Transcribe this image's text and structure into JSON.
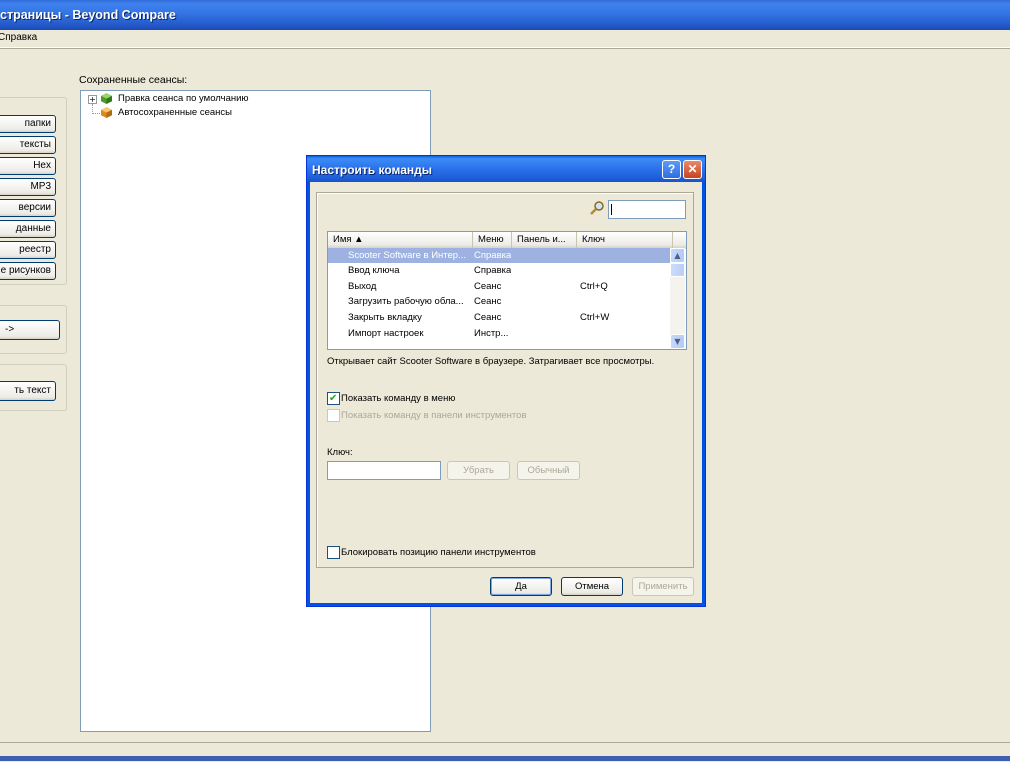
{
  "window": {
    "title": "страницы - Beyond Compare"
  },
  "menu": {
    "items": [
      "Справка"
    ]
  },
  "sidebar": {
    "buttons": [
      "папки",
      "тексты",
      "Hex",
      "MP3",
      "версии",
      "данные",
      "реестр",
      "е рисунков"
    ],
    "middle_button": "->",
    "bottom_button": "ть текст"
  },
  "sessions": {
    "label": "Сохраненные сеансы:",
    "items": [
      {
        "label": "Правка сеанса по умолчанию",
        "expandable": true,
        "icon": "green-cube-icon"
      },
      {
        "label": "Автосохраненные сеансы",
        "expandable": false,
        "icon": "orange-cube-icon"
      }
    ]
  },
  "dialog": {
    "title": "Настроить команды",
    "help_glyph": "?",
    "close_glyph": "✕",
    "search": {
      "value": "",
      "icon": "magnifier-icon"
    },
    "columns": [
      "Имя ▲",
      "Меню",
      "Панель и...",
      "Ключ"
    ],
    "rows": [
      {
        "name": "Scooter Software в Интер...",
        "menu": "Справка",
        "panel": "",
        "key": "",
        "selected": true
      },
      {
        "name": "Ввод ключа",
        "menu": "Справка",
        "panel": "",
        "key": "",
        "selected": false
      },
      {
        "name": "Выход",
        "menu": "Сеанс",
        "panel": "",
        "key": "Ctrl+Q",
        "selected": false
      },
      {
        "name": "Загрузить рабочую обла...",
        "menu": "Сеанс",
        "panel": "",
        "key": "",
        "selected": false
      },
      {
        "name": "Закрыть вкладку",
        "menu": "Сеанс",
        "panel": "",
        "key": "Ctrl+W",
        "selected": false
      },
      {
        "name": "Импорт настроек",
        "menu": "Инстр...",
        "panel": "",
        "key": "",
        "selected": false
      }
    ],
    "description": "Открывает сайт Scooter Software в браузере.  Затрагивает все просмотры.",
    "show_in_menu": {
      "label": "Показать команду в меню",
      "checked": true
    },
    "show_in_toolbar": {
      "label": "Показать команду в панели инструментов",
      "checked": false,
      "enabled": false
    },
    "key_label": "Ключ:",
    "key_value": "",
    "remove_button": "Убрать",
    "default_button": "Обычный",
    "lock_toolbar": {
      "label": "Блокировать позицию панели инструментов",
      "checked": false
    },
    "ok_button": "Да",
    "cancel_button": "Отмена",
    "apply_button": "Применить"
  }
}
